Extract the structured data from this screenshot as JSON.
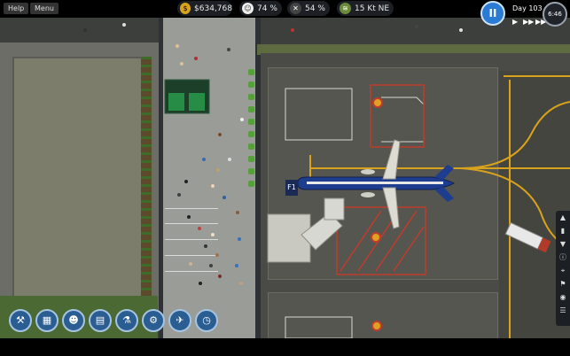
{
  "hud": {
    "help_label": "Help",
    "menu_label": "Menu",
    "money": "$634,768",
    "approval": "74 %",
    "security": "54 %",
    "wind": "15 Kt NE",
    "day": "Day 103",
    "time": "6:46",
    "pause_symbol": "II"
  },
  "map": {
    "gate_label": "F1"
  },
  "icons": {
    "money": "coin-icon",
    "approval": "approval-icon",
    "security": "security-icon",
    "wind": "wind-icon"
  },
  "colors": {
    "accent": "#2b7bd4",
    "taxi_line": "#d9a21b",
    "plane_blue": "#1f3d8f",
    "plane_white": "#dcdcd2"
  }
}
